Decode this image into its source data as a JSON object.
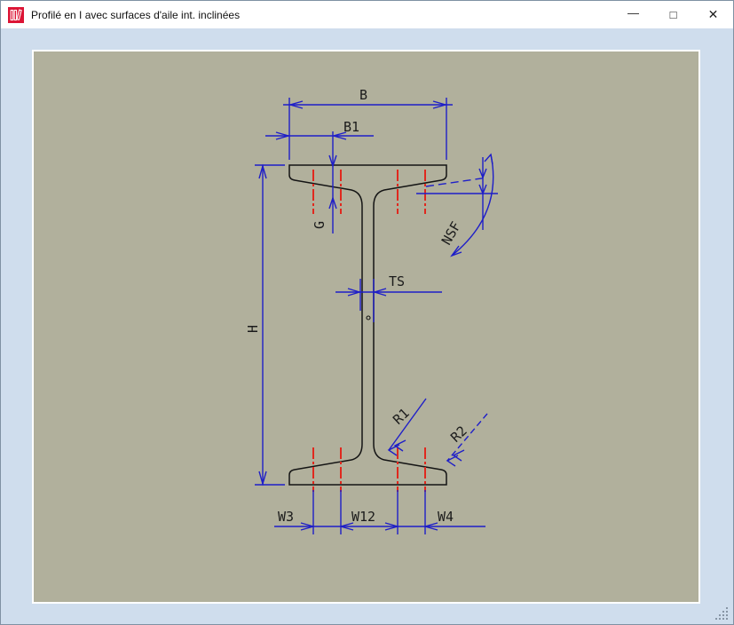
{
  "window": {
    "title": "Profilé en I avec surfaces d'aile int. inclinées",
    "controls": {
      "minimize_glyph": "—",
      "maximize_glyph": "□",
      "close_glyph": "✕"
    }
  },
  "drawing": {
    "dimension_labels": {
      "flange_width": "B",
      "flange_inner_width": "B1",
      "flange_thickness": "G",
      "profile_height": "H",
      "web_thickness": "TS",
      "flange_slope": "NSF",
      "fillet_radius": "R1",
      "edge_radius": "R2",
      "gauge_left": "W3",
      "gauge_middle": "W12",
      "gauge_right": "W4"
    },
    "colors": {
      "canvas_background": "#b1b09c",
      "client_background": "#cfdded",
      "dimension_line": "#1e1ec8",
      "gauge_line": "#e0281e",
      "profile_outline": "#141414",
      "titlebar_icon_red": "#dc1435"
    }
  }
}
